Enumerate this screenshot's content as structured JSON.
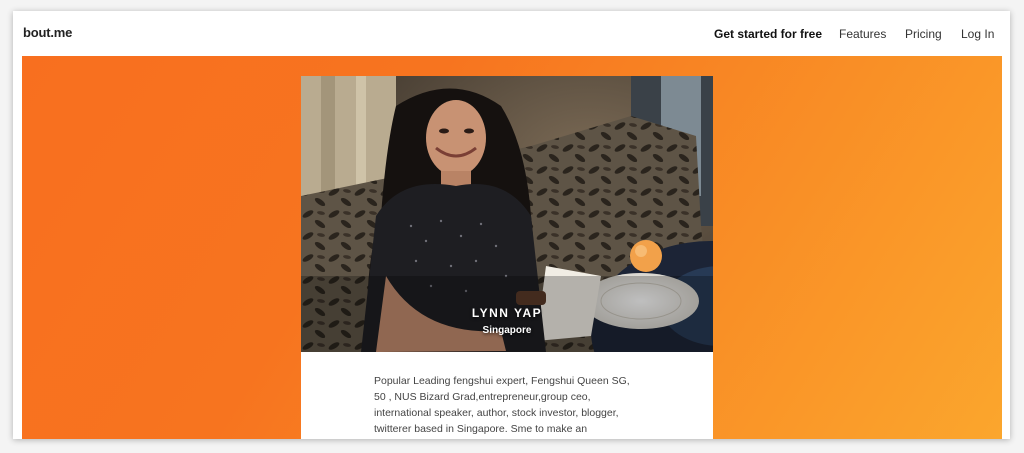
{
  "header": {
    "logo": "bout.me",
    "nav": {
      "get_started": "Get started for free",
      "features": "Features",
      "pricing": "Pricing",
      "login": "Log In"
    }
  },
  "profile": {
    "name": "LYNN YAP",
    "location": "Singapore",
    "bio_lines": [
      "Popular Leading fengshui expert, Fengshui Queen SG,",
      "50 , NUS Bizard Grad,entrepreneur,group ceo,",
      "international speaker, author, stock investor, blogger,",
      "twitterer based in Singapore. Sme to make an"
    ]
  },
  "colors": {
    "accent_orange": "#f7741f",
    "accent_yellow": "#fba62d"
  }
}
